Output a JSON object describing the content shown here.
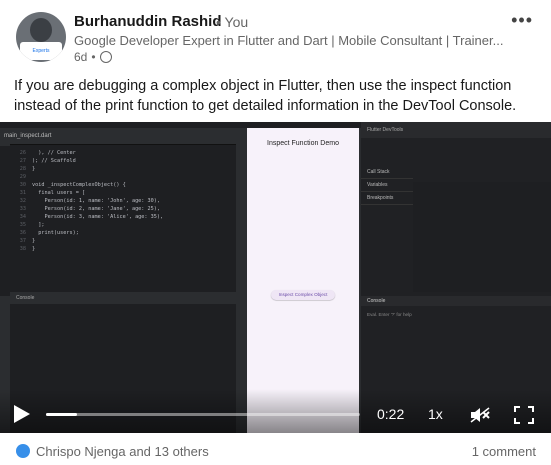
{
  "post": {
    "author": "Burhanuddin Rashid",
    "relation": "• You",
    "headline": "Google Developer Expert in Flutter and Dart | Mobile Consultant | Trainer...",
    "time": "6d",
    "avatar_badge": "Experts",
    "text": "If you are debugging a complex object in Flutter, then use the inspect function instead of the print function to get detailed information in the DevTool Console."
  },
  "video": {
    "current_time": "0:22",
    "speed": "1x",
    "progress": 0.1,
    "phone_title": "Inspect Function Demo",
    "phone_button": "Inspect Complex Object",
    "ide_tab": "main_inspect.dart",
    "console_label": "Console",
    "devtools_title": "Flutter DevTools",
    "devtools_panel": [
      "Call Stack",
      "Variables",
      "Breakpoints"
    ],
    "console_prompt": "Eval. Enter '?' for help",
    "code_lines": [
      {
        "n": "26",
        "t": "  ), // Center"
      },
      {
        "n": "27",
        "t": "); // Scaffold"
      },
      {
        "n": "28",
        "t": "}"
      },
      {
        "n": "29",
        "t": ""
      },
      {
        "n": "30",
        "t": "void _inspectComplexObject() {"
      },
      {
        "n": "31",
        "t": "  final users = ["
      },
      {
        "n": "32",
        "t": "    Person(id: 1, name: 'John', age: 30),"
      },
      {
        "n": "33",
        "t": "    Person(id: 2, name: 'Jane', age: 25),"
      },
      {
        "n": "34",
        "t": "    Person(id: 3, name: 'Alice', age: 35),"
      },
      {
        "n": "35",
        "t": "  ];"
      },
      {
        "n": "36",
        "t": "  print(users);"
      },
      {
        "n": "37",
        "t": "}"
      },
      {
        "n": "38",
        "t": "}"
      }
    ]
  },
  "footer": {
    "reactions": "Chrispo Njenga and 13 others",
    "comments": "1 comment"
  },
  "colors": {
    "accent": "#378fe9",
    "ide_bg": "#1e1f22"
  }
}
